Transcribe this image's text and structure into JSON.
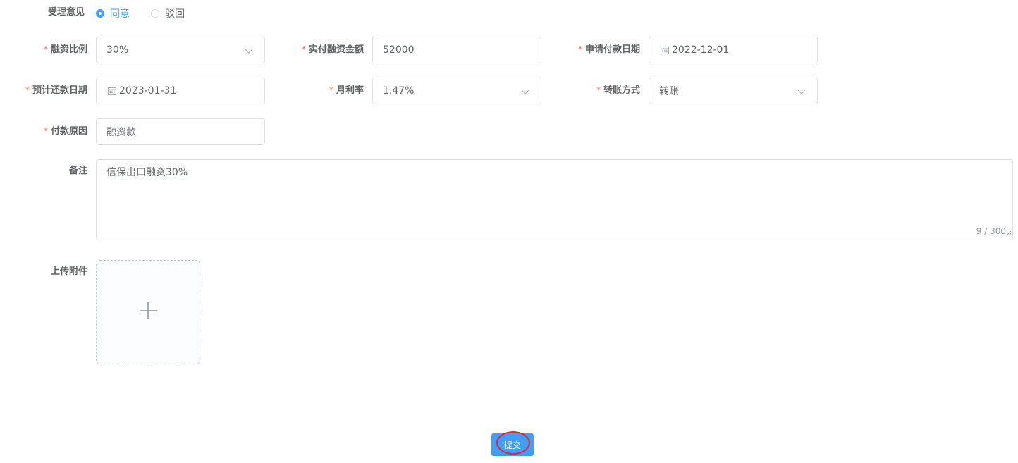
{
  "form": {
    "opinion": {
      "label": "受理意见",
      "options": [
        {
          "label": "同意",
          "checked": true
        },
        {
          "label": "驳回",
          "checked": false
        }
      ]
    },
    "fields": {
      "ratio": {
        "label": "融资比例",
        "value": "30%",
        "required": true
      },
      "actual_amount": {
        "label": "实付融资金额",
        "value": "52000",
        "required": true
      },
      "apply_date": {
        "label": "申请付款日期",
        "value": "2022-12-01",
        "required": true
      },
      "repay_date": {
        "label": "预计还款日期",
        "value": "2023-01-31",
        "required": true
      },
      "monthly_rate": {
        "label": "月利率",
        "value": "1.47%",
        "required": true
      },
      "transfer_method": {
        "label": "转账方式",
        "value": "转账",
        "required": true
      },
      "reason": {
        "label": "付款原因",
        "value": "融资款",
        "required": true
      }
    },
    "remark": {
      "label": "备注",
      "value": "信保出口融资30%",
      "counter": "9 / 300"
    },
    "attachment": {
      "label": "上传附件"
    },
    "required_mark": "*",
    "submit_label": "提交"
  },
  "icons": {
    "calendar": "calendar-icon",
    "chevron": "chevron-down-icon",
    "plus": "plus-icon"
  },
  "colors": {
    "primary": "#409eff",
    "required": "#f56c6c",
    "highlight_circle": "#e3242b"
  }
}
